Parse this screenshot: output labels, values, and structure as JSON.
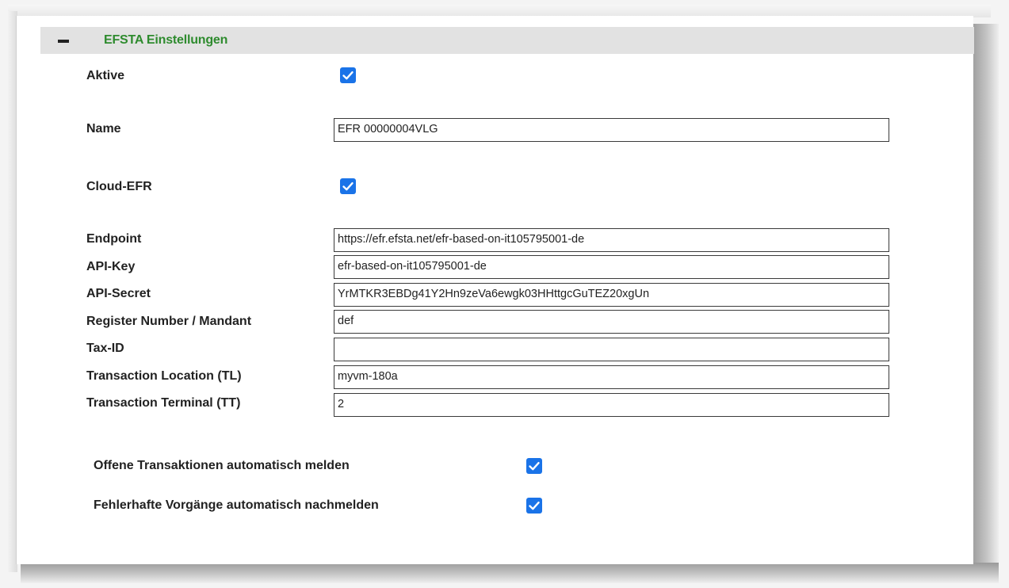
{
  "section": {
    "title": "EFSTA Einstellungen",
    "toggle_icon": "minus-icon"
  },
  "fields": {
    "aktive": {
      "label": "Aktive",
      "checked": true
    },
    "name": {
      "label": "Name",
      "value": "EFR 00000004VLG"
    },
    "cloud_efr": {
      "label": "Cloud-EFR",
      "checked": true
    },
    "endpoint": {
      "label": "Endpoint",
      "value": "https://efr.efsta.net/efr-based-on-it105795001-de"
    },
    "api_key": {
      "label": "API-Key",
      "value": "efr-based-on-it105795001-de"
    },
    "api_secret": {
      "label": "API-Secret",
      "value": "YrMTKR3EBDg41Y2Hn9zeVa6ewgk03HHttgcGuTEZ20xgUn"
    },
    "register_number": {
      "label": "Register Number / Mandant",
      "value": "def"
    },
    "tax_id": {
      "label": "Tax-ID",
      "value": ""
    },
    "transaction_location": {
      "label": "Transaction Location (TL)",
      "value": "myvm-180a"
    },
    "transaction_terminal": {
      "label": "Transaction Terminal (TT)",
      "value": "2"
    }
  },
  "options": {
    "offene_transaktionen": {
      "label": "Offene Transaktionen automatisch melden",
      "checked": true
    },
    "fehlerhafte_vorgaenge": {
      "label": "Fehlerhafte Vorgänge automatisch nachmelden",
      "checked": true
    }
  },
  "colors": {
    "checkbox": "#1a73e8",
    "section_title": "#2e8b2e",
    "section_header_bg": "#e2e2e2"
  }
}
